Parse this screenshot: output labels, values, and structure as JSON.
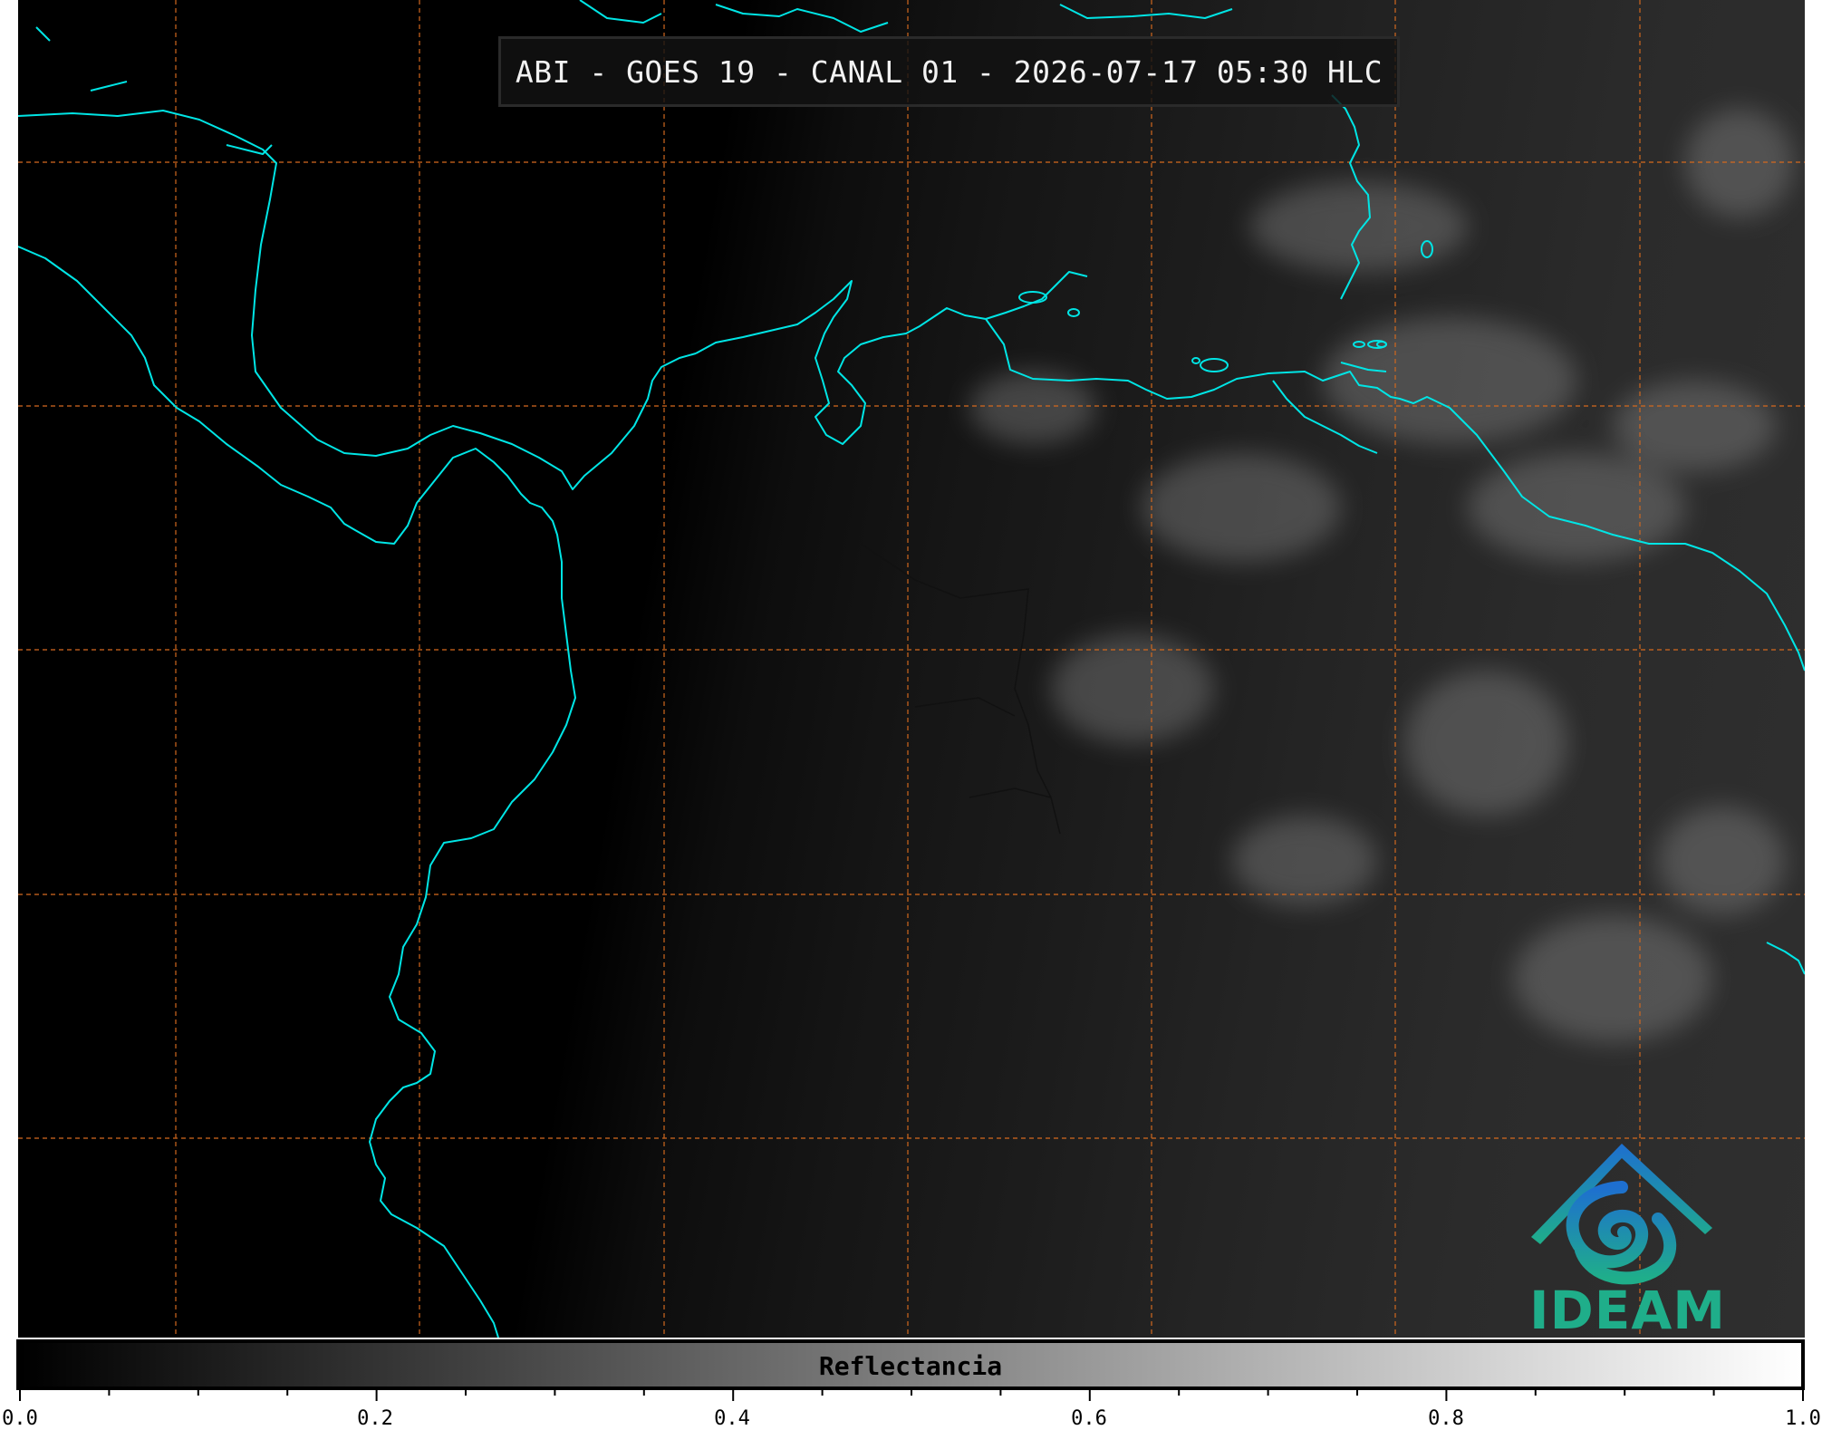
{
  "title": "ABI - GOES 19 - CANAL 01 - 2026-07-17 05:30 HLC",
  "colors": {
    "coastline": "#00e5e5",
    "gridline": "#d2691e",
    "logo_primary": "#1fae8a",
    "logo_secondary": "#1e7fc8"
  },
  "logo": {
    "text": "IDEAM",
    "icon": "ideam-logo-icon"
  },
  "colorbar": {
    "label": "Reflectancia",
    "range": [
      0.0,
      1.0
    ],
    "colormap": "gray",
    "tick_labels": [
      "0.0",
      "0.2",
      "0.4",
      "0.6",
      "0.8",
      "1.0"
    ]
  },
  "grid": {
    "visible": true,
    "style": "dashed"
  }
}
